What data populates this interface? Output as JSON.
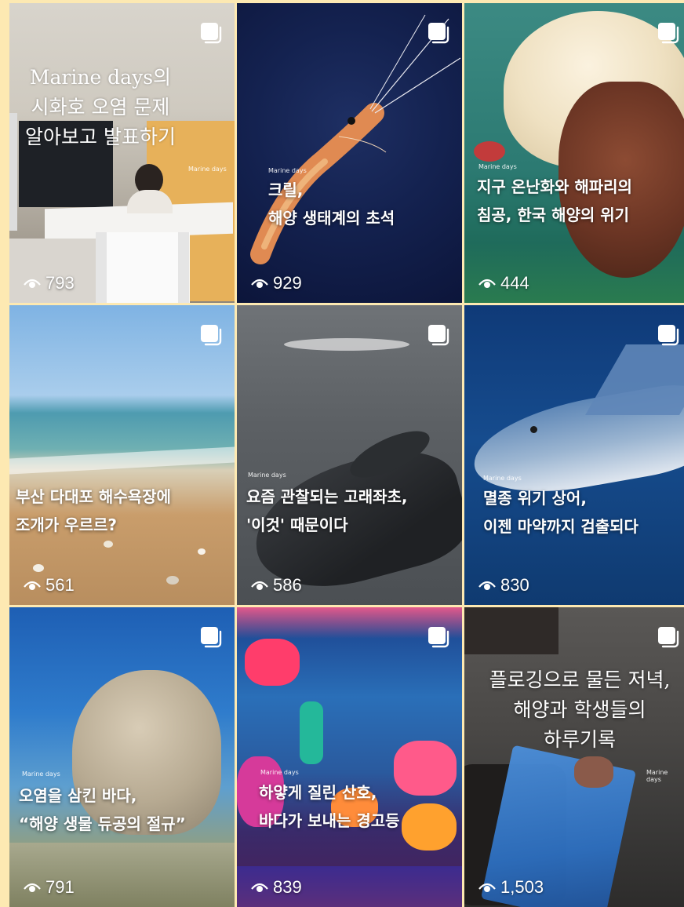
{
  "brand": "Marine days",
  "icons": {
    "multi": "multiple-images-icon",
    "views": "eye-icon"
  },
  "posts": [
    {
      "lines": [
        "Marine days의",
        "시화호 오염 문제",
        "알아보고 발표하기"
      ],
      "views": "793"
    },
    {
      "lines": [
        "크릴,",
        "해양 생태계의 초석"
      ],
      "views": "929"
    },
    {
      "lines": [
        "지구 온난화와 해파리의",
        "침공, 한국 해양의 위기"
      ],
      "views": "444"
    },
    {
      "lines": [
        "부산 다대포 해수욕장에",
        "조개가 우르르?"
      ],
      "views": "561"
    },
    {
      "lines": [
        "요즘 관찰되는 고래좌초,",
        "'이것' 때문이다"
      ],
      "views": "586"
    },
    {
      "lines": [
        "멸종 위기 상어,",
        "이젠 마약까지 검출되다"
      ],
      "views": "830"
    },
    {
      "lines": [
        "오염을 삼킨 바다,",
        "“해양 생물 듀공의 절규”"
      ],
      "views": "791"
    },
    {
      "lines": [
        "하얗게 질린 산호,",
        "바다가 보내는 경고등"
      ],
      "views": "839"
    },
    {
      "lines": [
        "플로깅으로 물든 저녁,",
        "해양과 학생들의",
        "하루기록"
      ],
      "views": "1,503"
    }
  ]
}
